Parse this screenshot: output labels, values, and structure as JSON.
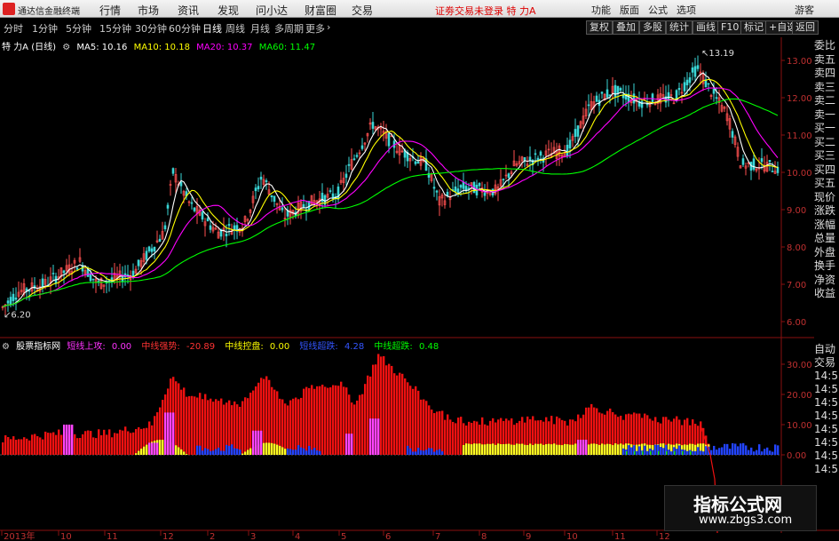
{
  "app": {
    "title": "通达信金融终端",
    "menu": [
      "行情",
      "市场",
      "资讯",
      "发现",
      "问小达",
      "财富圈",
      "交易"
    ],
    "notice": "证劵交易未登录 特 力A",
    "right_menu": [
      "功能",
      "版面",
      "公式",
      "选项"
    ],
    "guest": "游客"
  },
  "toolbar": {
    "periods": [
      "分时",
      "1分钟",
      "5分钟",
      "15分钟",
      "30分钟",
      "60分钟",
      "日线",
      "周线",
      "月线",
      "多周期",
      "更多"
    ],
    "active_period": "日线",
    "buttons": [
      "复权",
      "叠加",
      "多股",
      "统计",
      "画线",
      "F10",
      "标记",
      "+自选",
      "返回"
    ]
  },
  "main_chart": {
    "stock_label": "特 力A (日线)",
    "ma5": "MA5: 10.16",
    "ma10": "MA10: 10.18",
    "ma20": "MA20: 10.37",
    "ma60": "MA60: 11.47",
    "high_label": "13.19",
    "low_label": "6.20",
    "y_ticks": [
      "13.00",
      "12.00",
      "11.00",
      "10.00",
      "9.00",
      "8.00",
      "7.00",
      "6.00"
    ],
    "colors": {
      "ma5": "#ffffff",
      "ma10": "#ffff00",
      "ma20": "#ff00ff",
      "ma60": "#00ff00"
    }
  },
  "indicator": {
    "name": "股票指标网",
    "items": [
      {
        "label": "短线上攻:",
        "value": "0.00",
        "color": "#ff33ff"
      },
      {
        "label": "中线强势:",
        "value": "-20.89",
        "color": "#ff3333"
      },
      {
        "label": "中线控盘:",
        "value": "0.00",
        "color": "#ffff00"
      },
      {
        "label": "短线超跌:",
        "value": "4.28",
        "color": "#3333ff"
      },
      {
        "label": "中线超跌:",
        "value": "0.48",
        "color": "#00ff00"
      }
    ],
    "y_ticks": [
      "30.00",
      "20.00",
      "10.00",
      "0.00"
    ]
  },
  "side_panel": [
    "委比",
    "卖五",
    "卖四",
    "卖三",
    "卖二",
    "卖一",
    "买一",
    "买二",
    "买三",
    "买四",
    "买五",
    "现价",
    "涨跌",
    "涨幅",
    "总量",
    "外盘",
    "换手",
    "净资",
    "收益"
  ],
  "side_panel2": [
    "自动",
    "交易",
    "14:5",
    "14:5",
    "14:5",
    "14:5",
    "14:5",
    "14:5",
    "14:5",
    "14:5"
  ],
  "time_axis": [
    "2013年",
    "10",
    "11",
    "12",
    "2",
    "3",
    "4",
    "5",
    "6",
    "7",
    "8",
    "9",
    "10",
    "11",
    "12"
  ],
  "watermark": {
    "line1": "指标公式网",
    "line2": "www.zbgs3.com"
  }
}
